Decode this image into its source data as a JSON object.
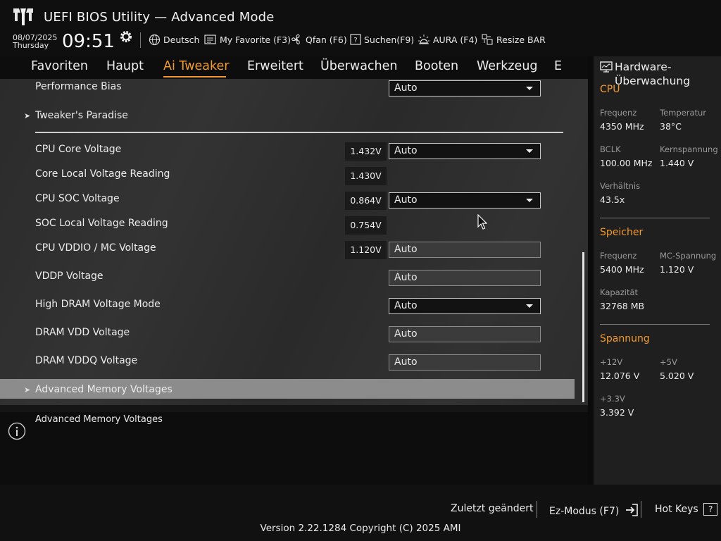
{
  "header": {
    "title": "UEFI BIOS Utility — Advanced Mode",
    "date": "08/07/2025",
    "day": "Thursday",
    "time": "09:51",
    "language": "Deutsch",
    "tools": {
      "favorite": "My Favorite (F3)",
      "qfan": "Qfan (F6)",
      "search": "Suchen(F9)",
      "aura": "AURA (F4)",
      "resize_bar": "Resize BAR"
    }
  },
  "nav": {
    "tabs": [
      "Favoriten",
      "Haupt",
      "Ai Tweaker",
      "Erweitert",
      "Überwachen",
      "Booten",
      "Werkzeug",
      "E"
    ],
    "active": "Ai Tweaker"
  },
  "main": {
    "items": [
      {
        "label": "Performance Bias",
        "value": "",
        "setting": "Auto",
        "control": "dropdown"
      },
      {
        "label": "Tweaker's Paradise",
        "value": "",
        "setting": "",
        "control": "submenu"
      },
      {
        "label": "CPU Core Voltage",
        "value": "1.432V",
        "setting": "Auto",
        "control": "dropdown"
      },
      {
        "label": "Core Local Voltage Reading",
        "value": "1.430V",
        "setting": "",
        "control": "readout"
      },
      {
        "label": "CPU SOC Voltage",
        "value": "0.864V",
        "setting": "Auto",
        "control": "dropdown"
      },
      {
        "label": "SOC Local Voltage Reading",
        "value": "0.754V",
        "setting": "",
        "control": "readout"
      },
      {
        "label": "CPU VDDIO / MC Voltage",
        "value": "1.120V",
        "setting": "Auto",
        "control": "field"
      },
      {
        "label": "VDDP Voltage",
        "value": "",
        "setting": "Auto",
        "control": "field"
      },
      {
        "label": "High DRAM Voltage Mode",
        "value": "",
        "setting": "Auto",
        "control": "dropdown"
      },
      {
        "label": "DRAM VDD Voltage",
        "value": "",
        "setting": "Auto",
        "control": "field"
      },
      {
        "label": "DRAM VDDQ Voltage",
        "value": "",
        "setting": "Auto",
        "control": "field"
      },
      {
        "label": "Advanced Memory Voltages",
        "value": "",
        "setting": "",
        "control": "submenu"
      }
    ],
    "selected": "Advanced Memory Voltages"
  },
  "help": {
    "text": "Advanced Memory Voltages"
  },
  "sidebar": {
    "title": "Hardware-Überwachung",
    "cpu": {
      "title": "CPU",
      "freq_label": "Frequenz",
      "freq": "4350 MHz",
      "temp_label": "Temperatur",
      "temp": "38°C",
      "bclk_label": "BCLK",
      "bclk": "100.00 MHz",
      "vcore_label": "Kernspannung",
      "vcore": "1.440 V",
      "ratio_label": "Verhältnis",
      "ratio": "43.5x"
    },
    "memory": {
      "title": "Speicher",
      "freq_label": "Frequenz",
      "freq": "5400 MHz",
      "mc_label": "MC-Spannung",
      "mc": "1.120 V",
      "cap_label": "Kapazität",
      "cap": "32768 MB"
    },
    "voltage": {
      "title": "Spannung",
      "v12_label": "+12V",
      "v12": "12.076 V",
      "v5_label": "+5V",
      "v5": "5.020 V",
      "v33_label": "+3.3V",
      "v33": "3.392 V"
    }
  },
  "footer": {
    "last_modified": "Zuletzt geändert",
    "ez_mode": "Ez-Modus (F7)",
    "hot_keys": "Hot Keys",
    "hot_keys_key": "?",
    "version": "Version 2.22.1284 Copyright (C) 2025 AMI"
  },
  "colors": {
    "accent": "#f29a2e",
    "selected_row": "#8c8c8c",
    "background": "#151515"
  }
}
